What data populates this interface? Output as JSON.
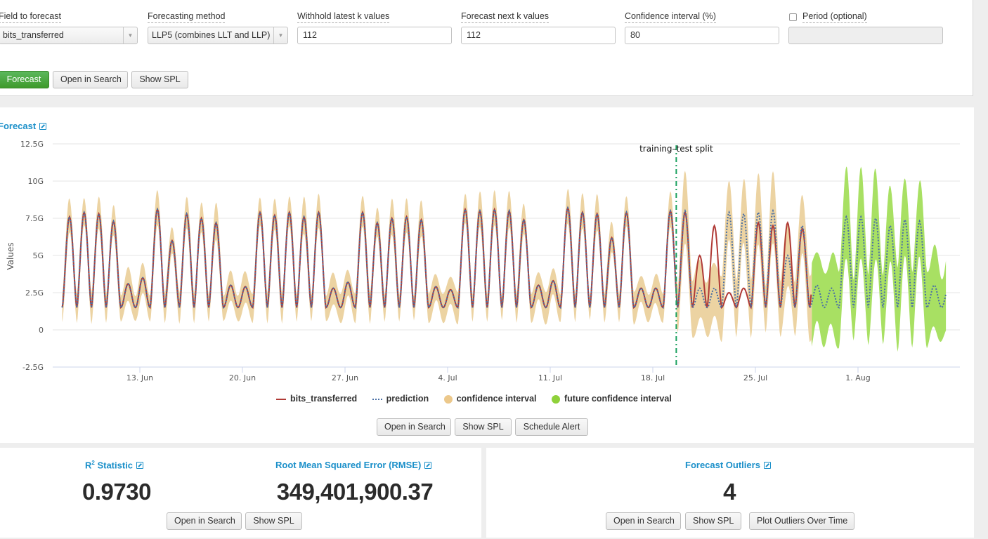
{
  "controls": {
    "field_to_forecast": {
      "label": "Field to forecast",
      "value": "bits_transferred"
    },
    "forecasting_method": {
      "label": "Forecasting method",
      "value": "LLP5 (combines LLT and LLP)"
    },
    "withhold": {
      "label": "Withhold latest k values",
      "value": "112"
    },
    "forecast_next": {
      "label": "Forecast next k values",
      "value": "112"
    },
    "confidence": {
      "label": "Confidence interval (%)",
      "value": "80"
    },
    "period": {
      "label": "Period (optional)",
      "value": "",
      "checked": false
    },
    "buttons": {
      "forecast": "Forecast",
      "open_in_search": "Open in Search",
      "show_spl": "Show SPL"
    }
  },
  "forecast_panel": {
    "title": "Forecast",
    "buttons": {
      "open_in_search": "Open in Search",
      "show_spl": "Show SPL",
      "schedule_alert": "Schedule Alert"
    }
  },
  "stats": {
    "r2": {
      "title_main": "R",
      "title_sup": "2",
      "title_rest": " Statistic",
      "value": "0.9730"
    },
    "rmse": {
      "title": "Root Mean Squared Error (RMSE)",
      "value": "349,401,900.37"
    },
    "buttons": {
      "open_in_search": "Open in Search",
      "show_spl": "Show SPL"
    }
  },
  "outliers": {
    "title": "Forecast Outliers",
    "value": "4",
    "buttons": {
      "open_in_search": "Open in Search",
      "show_spl": "Show SPL",
      "plot": "Plot Outliers Over Time"
    }
  },
  "colors": {
    "actual": "#b03a36",
    "prediction": "#4a6fa5",
    "confidence": "#ecd3a2",
    "future_confidence": "#a8e063",
    "split_line": "#1aa15f",
    "link": "#1a8fc9",
    "primary_button": "#4aa93a"
  },
  "chart_data": {
    "type": "line",
    "title": "Forecast",
    "xlabel": "",
    "ylabel": "Values",
    "ylim": [
      -2500000000,
      12500000000
    ],
    "yticks": [
      "-2.5G",
      "0",
      "2.5G",
      "5G",
      "7.5G",
      "10G",
      "12.5G"
    ],
    "ytick_values": [
      -2500000000,
      0,
      2500000000,
      5000000000,
      7500000000,
      10000000000,
      12500000000
    ],
    "xticks": [
      "13. Jun",
      "20. Jun",
      "27. Jun",
      "4. Jul",
      "11. Jul",
      "18. Jul",
      "25. Jul",
      "1. Aug"
    ],
    "x_start_day": 7.7,
    "x_end_day": 68.0,
    "xtick_days": [
      13,
      20,
      27,
      34,
      41,
      48,
      55,
      62
    ],
    "split_day": 49.6,
    "future_start_day": 58.8,
    "annotation": "training–test split",
    "grid": true,
    "legend": [
      "bits_transferred",
      "prediction",
      "confidence interval",
      "future confidence interval"
    ],
    "legend_position": "bottom",
    "daily_peaks_G": [
      7.6,
      7.9,
      7.8,
      7.3,
      3.1,
      3.5,
      8.1,
      6.0,
      7.8,
      7.5,
      7.2,
      3.0,
      2.9,
      7.9,
      7.7,
      7.9,
      7.6,
      7.9,
      2.8,
      3.2,
      7.9,
      7.2,
      7.5,
      7.6,
      7.4,
      2.9,
      2.7,
      8.1,
      8.0,
      8.1,
      8.0,
      7.4,
      3.0,
      3.3,
      8.2,
      7.9,
      7.8,
      6.2,
      7.9,
      2.8,
      2.8,
      8.0,
      8.0,
      2.8,
      2.8,
      7.9,
      7.8,
      7.9,
      8.0,
      5.0,
      7.0,
      3.0,
      2.8,
      7.6,
      7.6,
      7.5,
      7.0,
      7.4,
      7.3,
      3.0,
      2.9,
      7.8,
      7.8,
      7.8,
      7.0,
      7.0,
      3.0,
      3.0
    ],
    "actual_peaks_test_G": [
      7.9,
      7.9,
      5.0,
      7.0,
      2.5,
      2.8,
      7.2,
      7.0,
      7.2,
      6.8,
      7.2
    ],
    "trough_G": 1.5,
    "band_halfwidth_G": {
      "training": 1.0,
      "test": 2.0,
      "future": 2.6
    }
  }
}
